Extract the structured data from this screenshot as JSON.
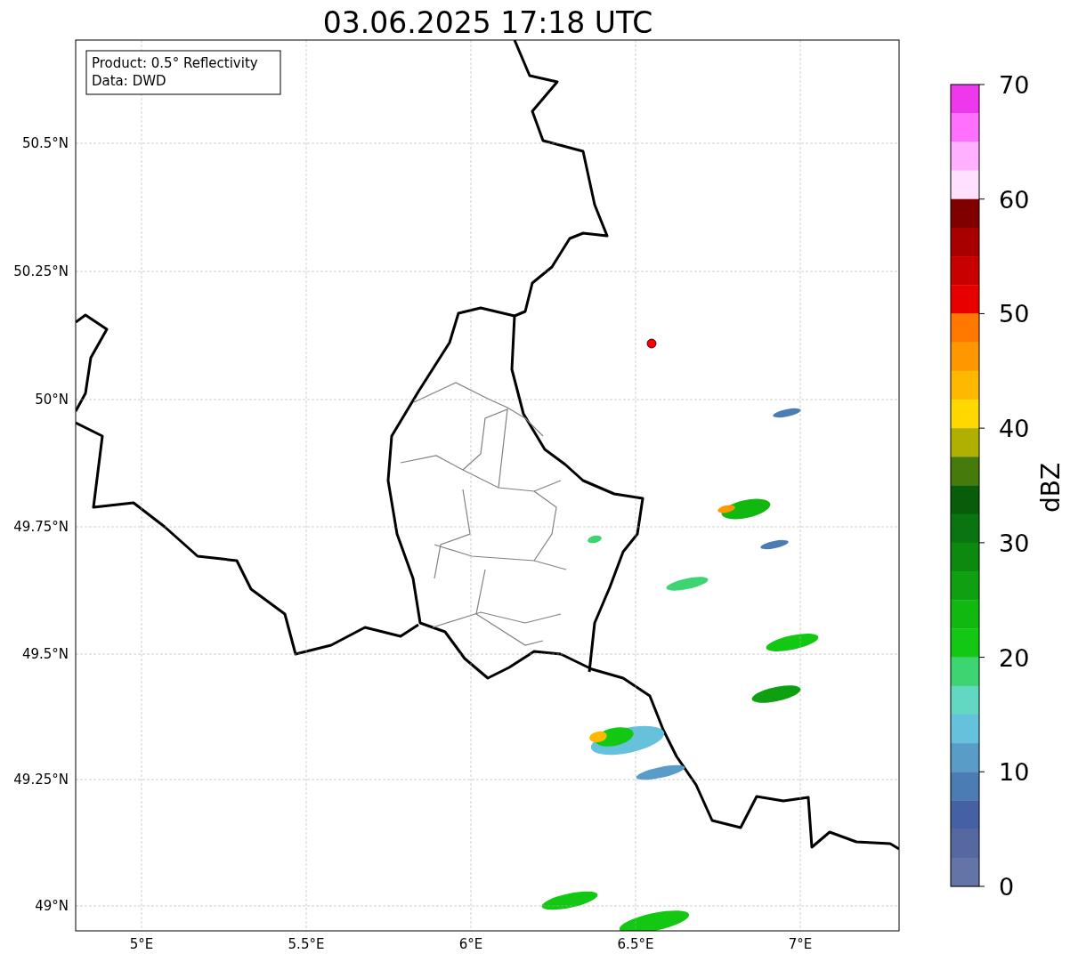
{
  "title": "03.06.2025 17:18 UTC",
  "legend": {
    "lines": [
      "Product: 0.5° Reflectivity",
      "Data: DWD"
    ]
  },
  "x_axis": {
    "ticks": [
      "5°E",
      "5.5°E",
      "6°E",
      "6.5°E",
      "7°E"
    ]
  },
  "y_axis": {
    "ticks": [
      "50.5°N",
      "50.25°N",
      "50°N",
      "49.75°N",
      "49.5°N",
      "49.25°N",
      "49°N"
    ]
  },
  "colorbar": {
    "label": "dBZ",
    "ticks": [
      "70",
      "60",
      "50",
      "40",
      "30",
      "20",
      "10",
      "0"
    ],
    "segments": [
      {
        "color": "#ee38ee"
      },
      {
        "color": "#ff70ff"
      },
      {
        "color": "#ffb0ff"
      },
      {
        "color": "#ffe0ff"
      },
      {
        "color": "#800000"
      },
      {
        "color": "#a80000"
      },
      {
        "color": "#c80000"
      },
      {
        "color": "#e80000"
      },
      {
        "color": "#ff7800"
      },
      {
        "color": "#ff9800"
      },
      {
        "color": "#ffb800"
      },
      {
        "color": "#ffd800"
      },
      {
        "color": "#b0b000"
      },
      {
        "color": "#467a0a"
      },
      {
        "color": "#085c0a"
      },
      {
        "color": "#0a7410"
      },
      {
        "color": "#0c8a10"
      },
      {
        "color": "#0ea010"
      },
      {
        "color": "#10b810"
      },
      {
        "color": "#12c812"
      },
      {
        "color": "#3ed472"
      },
      {
        "color": "#62d8c2"
      },
      {
        "color": "#66c2dc"
      },
      {
        "color": "#5a9cc8"
      },
      {
        "color": "#4c7cb4"
      },
      {
        "color": "#4660a4"
      },
      {
        "color": "#5668a0"
      },
      {
        "color": "#6474a6"
      }
    ]
  }
}
